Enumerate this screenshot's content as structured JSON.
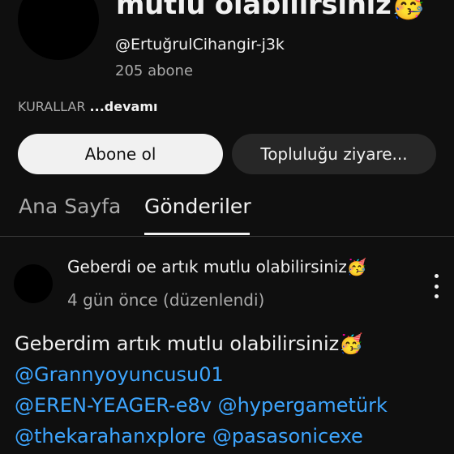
{
  "channel": {
    "title": "mutlu olabilirsiniz🥳",
    "handle": "@ErtuğrulCihangir-j3k",
    "subscribers": "205 abone",
    "rules_label": "KURALLAR",
    "rules_more": "...devamı"
  },
  "actions": {
    "subscribe_label": "Abone ol",
    "visit_label": "Topluluğu ziyare..."
  },
  "tabs": [
    {
      "label": "Ana Sayfa",
      "active": false
    },
    {
      "label": "Gönderiler",
      "active": true
    }
  ],
  "post": {
    "author": "Geberdi oe artık mutlu olabilirsiniz🥳",
    "time": "4 gün önce (düzenlendi)",
    "text_line": "Geberdim artık mutlu olabilirsiniz🥳",
    "mentions_line1": "@Grannyoyuncusu01",
    "mentions_line2a": "@EREN-YEAGER-e8v",
    "mentions_line2b": "@hypergametürk",
    "mentions_line3a": "@thekarahanxplore",
    "mentions_line3b": "@pasasonicexe"
  },
  "colors": {
    "background": "#0f0f0f",
    "link": "#3ea6ff",
    "secondary_text": "#aaaaaa"
  }
}
